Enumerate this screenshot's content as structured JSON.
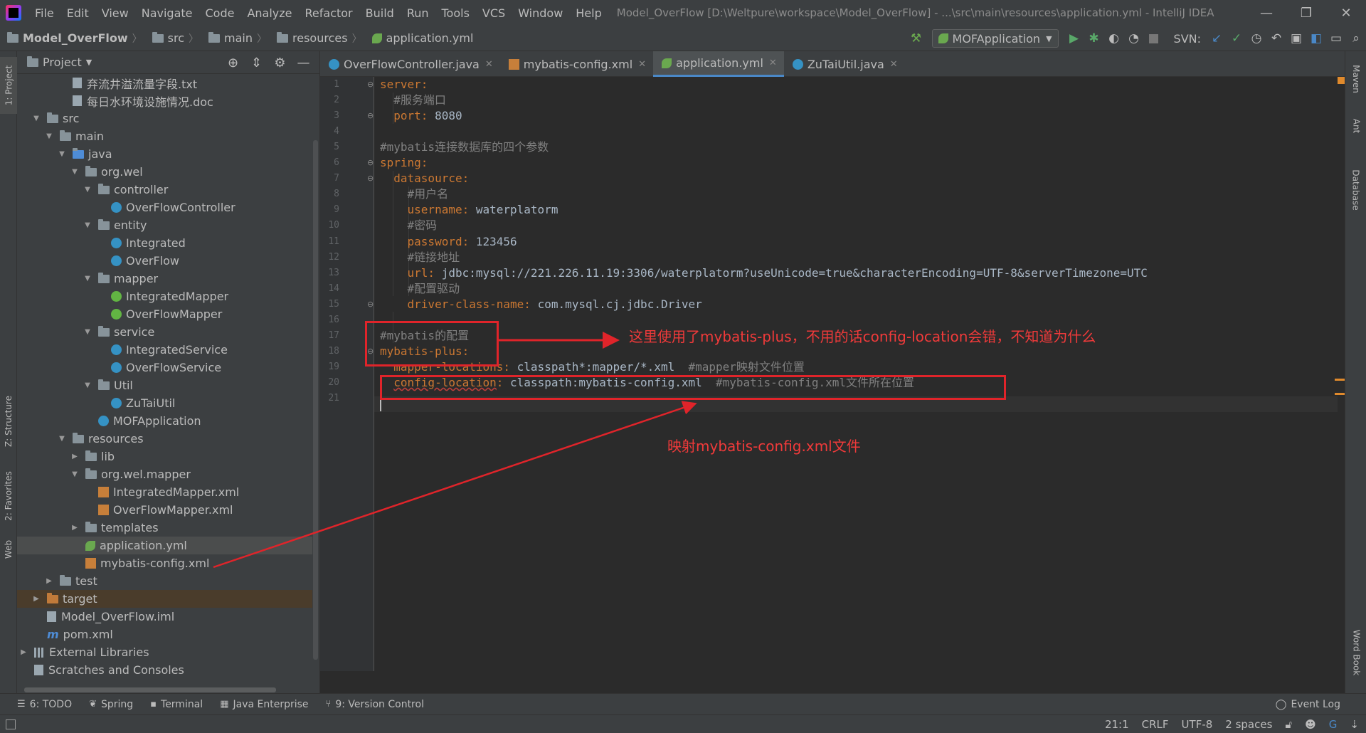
{
  "menubar": {
    "items": [
      "File",
      "Edit",
      "View",
      "Navigate",
      "Code",
      "Analyze",
      "Refactor",
      "Build",
      "Run",
      "Tools",
      "VCS",
      "Window",
      "Help"
    ],
    "window_title": "Model_OverFlow [D:\\Weltpure\\workspace\\Model_OverFlow] - ...\\src\\main\\resources\\application.yml - IntelliJ IDEA"
  },
  "breadcrumb": [
    "Model_OverFlow",
    "src",
    "main",
    "resources",
    "application.yml"
  ],
  "toolbar": {
    "run_config": "MOFApplication",
    "svn_label": "SVN:"
  },
  "left_stripe": {
    "project": "1: Project",
    "structure": "Z: Structure",
    "favorites": "2: Favorites",
    "web": "Web"
  },
  "project_panel": {
    "title": "Project",
    "tree": [
      {
        "label": "弃流井溢流量字段.txt",
        "depth": 3,
        "icon": "file",
        "arrow": ""
      },
      {
        "label": "每日水环境设施情况.doc",
        "depth": 3,
        "icon": "file",
        "arrow": ""
      },
      {
        "label": "src",
        "depth": 1,
        "icon": "folder",
        "arrow": "▼"
      },
      {
        "label": "main",
        "depth": 2,
        "icon": "folder",
        "arrow": "▼"
      },
      {
        "label": "java",
        "depth": 3,
        "icon": "folder-blue",
        "arrow": "▼"
      },
      {
        "label": "org.wel",
        "depth": 4,
        "icon": "package",
        "arrow": "▼"
      },
      {
        "label": "controller",
        "depth": 5,
        "icon": "package",
        "arrow": "▼"
      },
      {
        "label": "OverFlowController",
        "depth": 6,
        "icon": "class",
        "arrow": ""
      },
      {
        "label": "entity",
        "depth": 5,
        "icon": "package",
        "arrow": "▼"
      },
      {
        "label": "Integrated",
        "depth": 6,
        "icon": "class",
        "arrow": ""
      },
      {
        "label": "OverFlow",
        "depth": 6,
        "icon": "class",
        "arrow": ""
      },
      {
        "label": "mapper",
        "depth": 5,
        "icon": "package",
        "arrow": "▼"
      },
      {
        "label": "IntegratedMapper",
        "depth": 6,
        "icon": "interface",
        "arrow": ""
      },
      {
        "label": "OverFlowMapper",
        "depth": 6,
        "icon": "interface",
        "arrow": ""
      },
      {
        "label": "service",
        "depth": 5,
        "icon": "package",
        "arrow": "▼"
      },
      {
        "label": "IntegratedService",
        "depth": 6,
        "icon": "class",
        "arrow": ""
      },
      {
        "label": "OverFlowService",
        "depth": 6,
        "icon": "class",
        "arrow": ""
      },
      {
        "label": "Util",
        "depth": 5,
        "icon": "package",
        "arrow": "▼"
      },
      {
        "label": "ZuTaiUtil",
        "depth": 6,
        "icon": "class",
        "arrow": ""
      },
      {
        "label": "MOFApplication",
        "depth": 5,
        "icon": "class",
        "arrow": ""
      },
      {
        "label": "resources",
        "depth": 3,
        "icon": "folder",
        "arrow": "▼"
      },
      {
        "label": "lib",
        "depth": 4,
        "icon": "folder",
        "arrow": "▶"
      },
      {
        "label": "org.wel.mapper",
        "depth": 4,
        "icon": "folder",
        "arrow": "▼"
      },
      {
        "label": "IntegratedMapper.xml",
        "depth": 5,
        "icon": "xml",
        "arrow": ""
      },
      {
        "label": "OverFlowMapper.xml",
        "depth": 5,
        "icon": "xml",
        "arrow": ""
      },
      {
        "label": "templates",
        "depth": 4,
        "icon": "folder",
        "arrow": "▶"
      },
      {
        "label": "application.yml",
        "depth": 4,
        "icon": "yml",
        "arrow": "",
        "selected": true
      },
      {
        "label": "mybatis-config.xml",
        "depth": 4,
        "icon": "xml",
        "arrow": ""
      },
      {
        "label": "test",
        "depth": 2,
        "icon": "folder",
        "arrow": "▶"
      },
      {
        "label": "target",
        "depth": 1,
        "icon": "folder-orange",
        "arrow": "▶",
        "excluded": true
      },
      {
        "label": "Model_OverFlow.iml",
        "depth": 1,
        "icon": "file",
        "arrow": ""
      },
      {
        "label": "pom.xml",
        "depth": 1,
        "icon": "maven",
        "arrow": ""
      },
      {
        "label": "External Libraries",
        "depth": 0,
        "icon": "lib",
        "arrow": "▶"
      },
      {
        "label": "Scratches and Consoles",
        "depth": 0,
        "icon": "scratch",
        "arrow": ""
      }
    ]
  },
  "tabs": [
    {
      "label": "OverFlowController.java",
      "icon": "class"
    },
    {
      "label": "mybatis-config.xml",
      "icon": "xml"
    },
    {
      "label": "application.yml",
      "icon": "yml",
      "active": true
    },
    {
      "label": "ZuTaiUtil.java",
      "icon": "class"
    }
  ],
  "editor": {
    "lines": [
      [
        {
          "t": "server:",
          "c": "key"
        }
      ],
      [
        {
          "t": "  #服务端口",
          "c": "cmt"
        }
      ],
      [
        {
          "t": "  port: ",
          "c": "key"
        },
        {
          "t": "8080",
          "c": "val"
        }
      ],
      [],
      [
        {
          "t": "#mybatis连接数据库的四个参数",
          "c": "cmt"
        }
      ],
      [
        {
          "t": "spring:",
          "c": "key"
        }
      ],
      [
        {
          "t": "  datasource:",
          "c": "key"
        }
      ],
      [
        {
          "t": "    #用户名",
          "c": "cmt"
        }
      ],
      [
        {
          "t": "    username: ",
          "c": "key"
        },
        {
          "t": "waterplatorm",
          "c": "val"
        }
      ],
      [
        {
          "t": "    #密码",
          "c": "cmt"
        }
      ],
      [
        {
          "t": "    password: ",
          "c": "key"
        },
        {
          "t": "123456",
          "c": "val"
        }
      ],
      [
        {
          "t": "    #链接地址",
          "c": "cmt"
        }
      ],
      [
        {
          "t": "    url: ",
          "c": "key"
        },
        {
          "t": "jdbc:mysql://221.226.11.19:3306/waterplatorm?useUnicode=true&characterEncoding=UTF-8&serverTimezone=UTC",
          "c": "val"
        }
      ],
      [
        {
          "t": "    #配置驱动",
          "c": "cmt"
        }
      ],
      [
        {
          "t": "    driver-class-name: ",
          "c": "key"
        },
        {
          "t": "com.mysql.cj.jdbc.Driver",
          "c": "val"
        }
      ],
      [],
      [
        {
          "t": "#mybatis的配置",
          "c": "cmt"
        }
      ],
      [
        {
          "t": "mybatis-plus:",
          "c": "key"
        }
      ],
      [
        {
          "t": "  mapper-locations: ",
          "c": "key"
        },
        {
          "t": "classpath*:mapper/*.xml  ",
          "c": "val"
        },
        {
          "t": "#mapper映射文件位置",
          "c": "cmt"
        }
      ],
      [
        {
          "t": "  ",
          "c": "key"
        },
        {
          "t": "config-location",
          "c": "key underline-red"
        },
        {
          "t": ": ",
          "c": "key"
        },
        {
          "t": "classpath:mybatis-config.xml  ",
          "c": "val"
        },
        {
          "t": "#mybatis-config.xml文件所在位置",
          "c": "cmt"
        }
      ],
      []
    ]
  },
  "annotations": {
    "note_mybatis_plus": "这里使用了mybatis-plus，不用的话config-location会错，不知道为什么",
    "note_mapping": "映射mybatis-config.xml文件"
  },
  "right_stripe": {
    "maven": "Maven",
    "ant": "Ant",
    "database": "Database",
    "word_book": "Word Book"
  },
  "bottom_tools": [
    {
      "label": "6: TODO",
      "icon": "todo-icon"
    },
    {
      "label": "Spring",
      "icon": "spring-icon"
    },
    {
      "label": "Terminal",
      "icon": "terminal-icon"
    },
    {
      "label": "Java Enterprise",
      "icon": "java-enterprise-icon"
    },
    {
      "label": "9: Version Control",
      "icon": "version-control-icon"
    }
  ],
  "event_log": "Event Log",
  "statusbar": {
    "position": "21:1",
    "line_sep": "CRLF",
    "encoding": "UTF-8",
    "indent": "2 spaces"
  },
  "colors": {
    "keyword": "#cc7832",
    "comment": "#808080",
    "annotation": "#e0242a",
    "accent": "#4a88c7"
  }
}
